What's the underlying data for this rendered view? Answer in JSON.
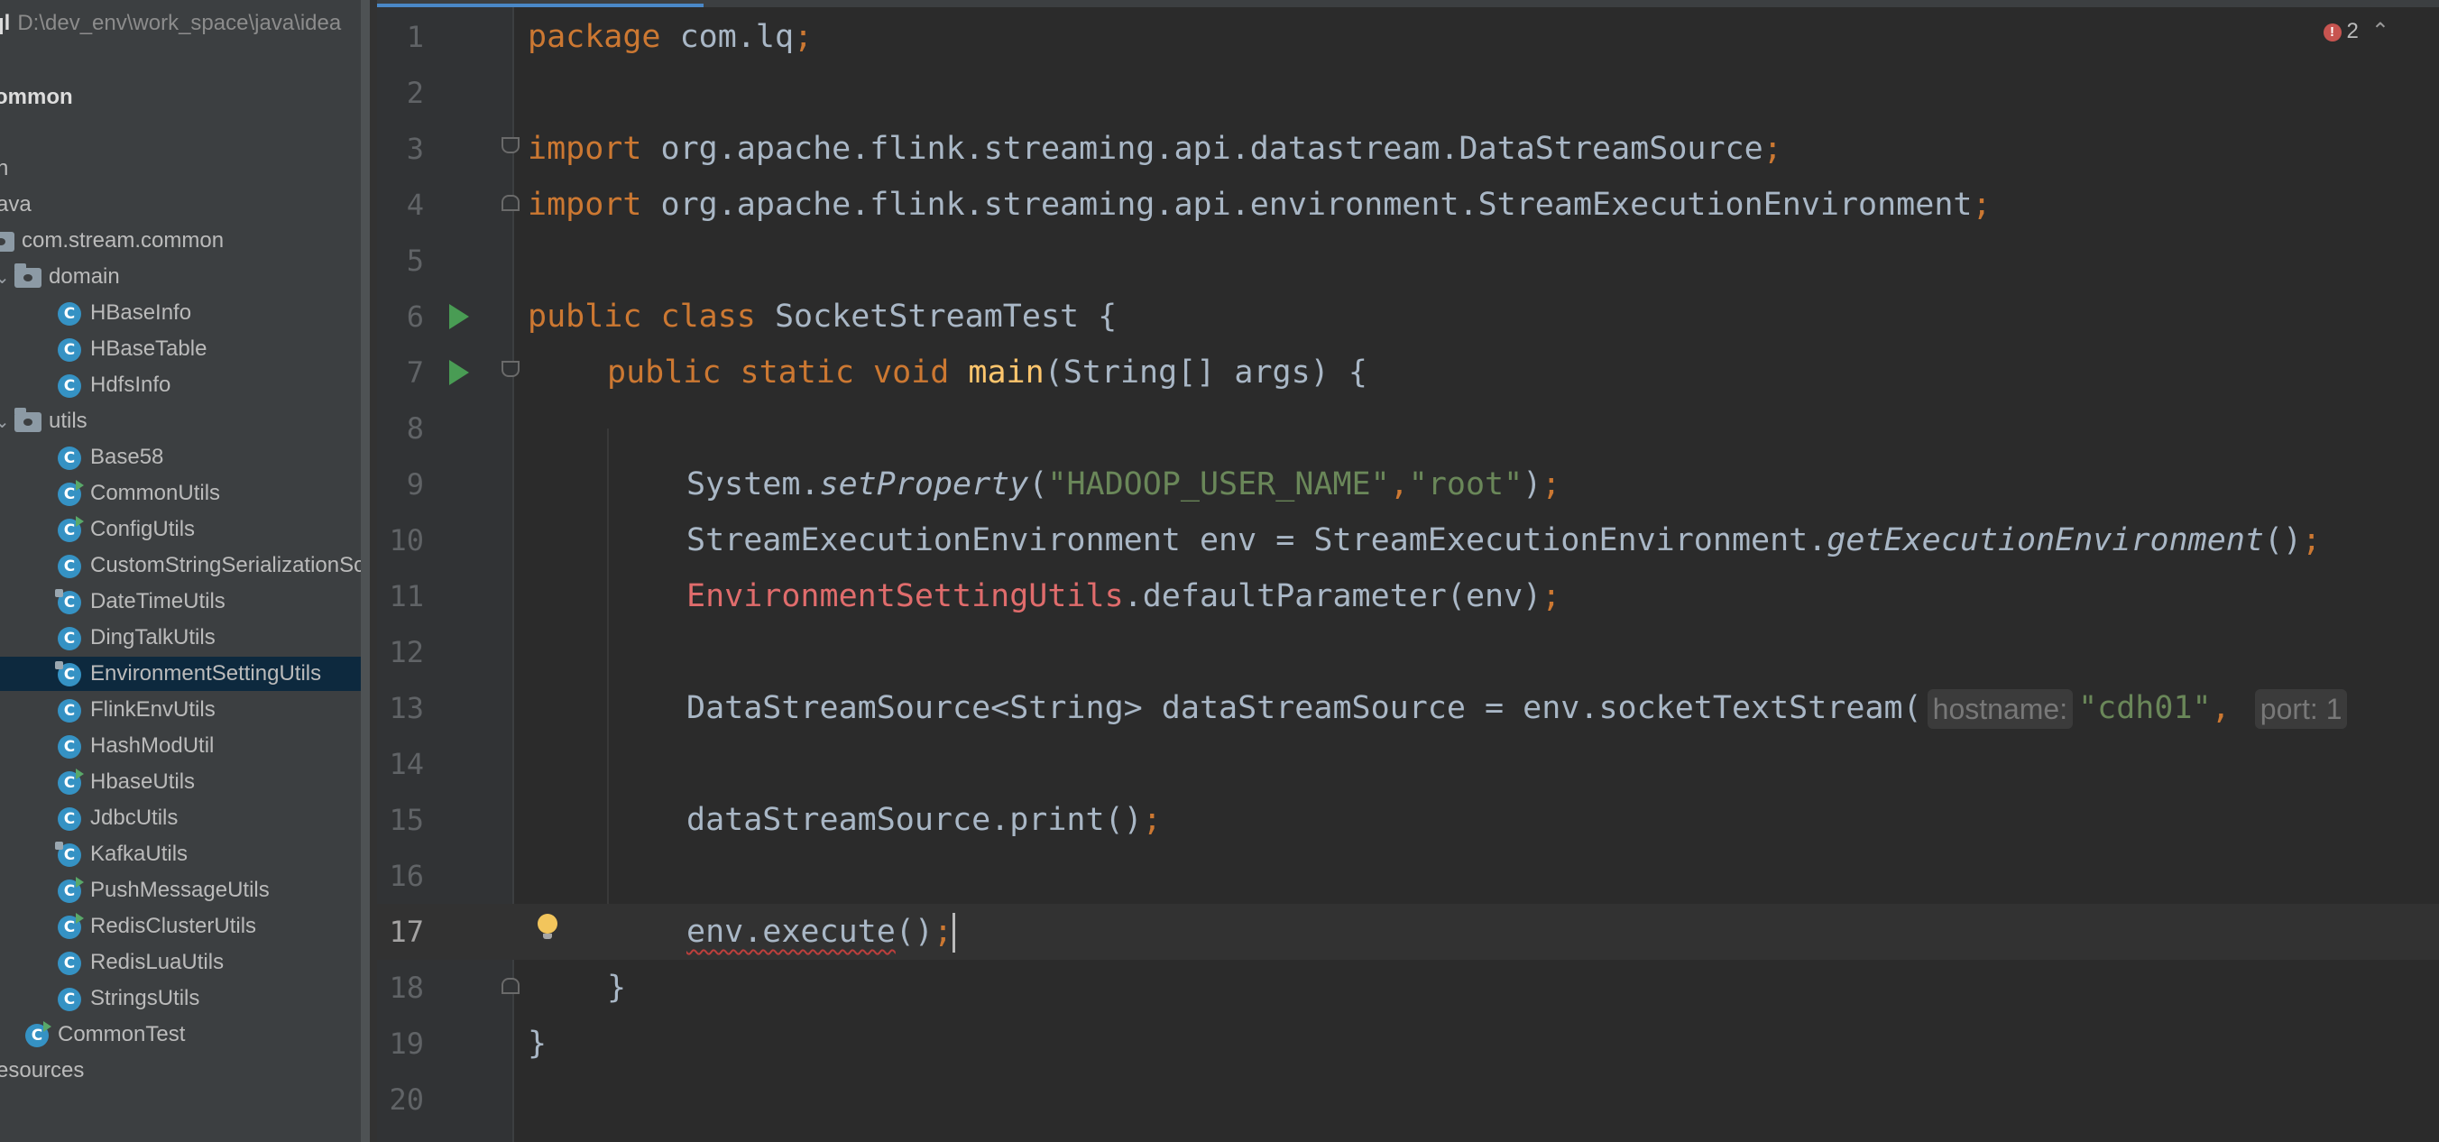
{
  "project_panel": {
    "project_name": "ql",
    "project_path": "D:\\dev_env\\work_space\\java\\idea",
    "module": "ommon",
    "src_fragment": "n",
    "java_folder": "ava",
    "package": "com.stream.common",
    "domain_folder": "domain",
    "domain_classes": [
      "HBaseInfo",
      "HBaseTable",
      "HdfsInfo"
    ],
    "utils_folder": "utils",
    "utils_classes": [
      "Base58",
      "CommonUtils",
      "ConfigUtils",
      "CustomStringSerializationSc",
      "DateTimeUtils",
      "DingTalkUtils",
      "EnvironmentSettingUtils",
      "FlinkEnvUtils",
      "HashModUtil",
      "HbaseUtils",
      "JdbcUtils",
      "KafkaUtils",
      "PushMessageUtils",
      "RedisClusterUtils",
      "RedisLuaUtils",
      "StringsUtils"
    ],
    "selected_class": "EnvironmentSettingUtils",
    "test_class": "CommonTest",
    "resources_folder": "esources",
    "class_icon_letter": "C"
  },
  "editor": {
    "error_count": "2",
    "line_numbers": [
      "1",
      "2",
      "3",
      "4",
      "5",
      "6",
      "7",
      "8",
      "9",
      "10",
      "11",
      "12",
      "13",
      "14",
      "15",
      "16",
      "17",
      "18",
      "19",
      "20"
    ],
    "current_line": "17",
    "code": {
      "l1": {
        "kw": "package",
        "rest": " com.lq",
        "semi": ";"
      },
      "l3": {
        "kw": "import",
        "rest": " org.apache.flink.streaming.api.datastream.DataStreamSource",
        "semi": ";"
      },
      "l4": {
        "kw": "import",
        "rest": " org.apache.flink.streaming.api.environment.StreamExecutionEnvironment",
        "semi": ";"
      },
      "l6": {
        "kw": "public class",
        "name": " SocketStreamTest {"
      },
      "l7": {
        "kw": "public static void",
        "fn": "main",
        "rest": "(String[] args) {"
      },
      "l9": {
        "a": "System.",
        "it": "setProperty",
        "b": "(",
        "s1": "\"HADOOP_USER_NAME\"",
        "c": ",",
        "s2": "\"root\"",
        "d": ")",
        "semi": ";"
      },
      "l10": {
        "a": "StreamExecutionEnvironment env = StreamExecutionEnvironment.",
        "it": "getExecutionEnvironment",
        "b": "()",
        "semi": ";"
      },
      "l11": {
        "err": "EnvironmentSettingUtils",
        "rest": ".defaultParameter(env)",
        "semi": ";"
      },
      "l13": {
        "a": "DataStreamSource<String> dataStreamSource = env.socketTextStream(",
        "hint1": "hostname:",
        "s1": "\"cdh01\"",
        "c": ",",
        "hint2": "port: 1"
      },
      "l15": {
        "a": "dataStreamSource.print()",
        "semi": ";"
      },
      "l17": {
        "squig": "env.execute",
        "a": "()",
        "semi": ";"
      },
      "l18": {
        "a": "}"
      },
      "l19": {
        "a": "}"
      }
    }
  }
}
